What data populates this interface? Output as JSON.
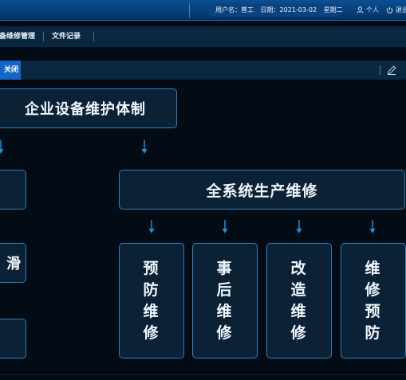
{
  "topbar": {
    "user_label": "用户名：曾工",
    "date_label": "日期：2021-03-02",
    "weekday": "星期二",
    "personal": "个人",
    "logout": "退出"
  },
  "menu": {
    "items": [
      "设备维修管理",
      "文件记录"
    ]
  },
  "tabs": {
    "active_label": "关闭"
  },
  "diagram": {
    "title": "企业设备维护体制",
    "left_box_2": "滑",
    "main": "全系统生产维修",
    "children": [
      "预防维修",
      "事后维修",
      "改造维修",
      "维修预防"
    ]
  },
  "colors": {
    "topbar": "#0b4f93",
    "panel": "#0a2740",
    "node_border": "#2f7fc0",
    "arrow": "#1e90e0",
    "active_tab": "#1565c8"
  }
}
